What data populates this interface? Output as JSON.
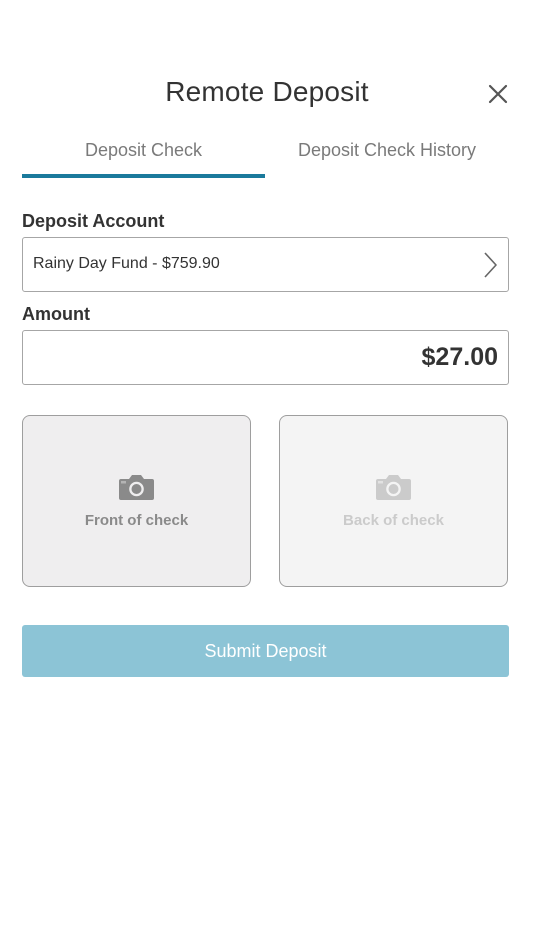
{
  "header": {
    "title": "Remote Deposit"
  },
  "tabs": [
    {
      "label": "Deposit Check",
      "active": true
    },
    {
      "label": "Deposit Check History",
      "active": false
    }
  ],
  "form": {
    "account_label": "Deposit Account",
    "account_value": "Rainy Day Fund - $759.90",
    "amount_label": "Amount",
    "amount_value": "$27.00"
  },
  "checks": {
    "front_label": "Front of check",
    "back_label": "Back of check",
    "icon": "camera-icon"
  },
  "actions": {
    "submit_label": "Submit Deposit"
  },
  "colors": {
    "accent": "#1a7a9c",
    "submit_disabled": "#8cc4d6",
    "text": "#333333",
    "muted": "#7a7a7a"
  }
}
